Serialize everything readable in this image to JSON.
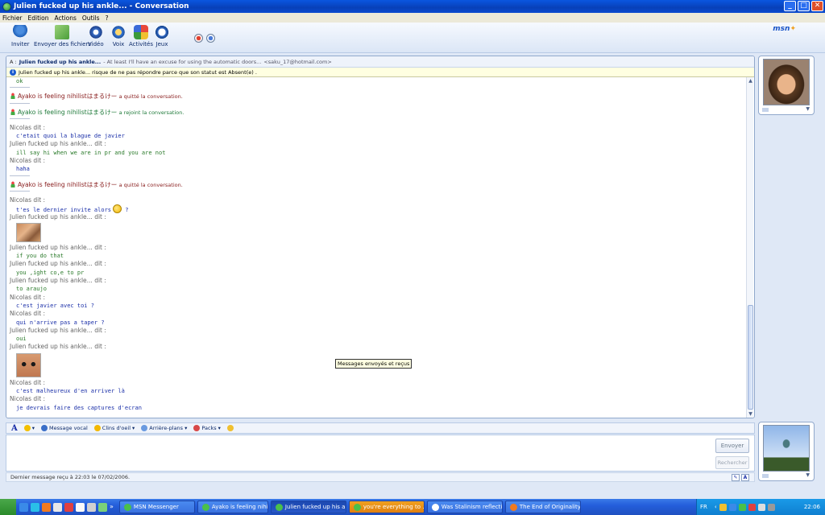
{
  "window": {
    "title": "Julien fucked up his ankle... - Conversation",
    "controls": [
      "_",
      "□",
      "✕"
    ]
  },
  "menu": [
    "Fichier",
    "Edition",
    "Actions",
    "Outils",
    "?"
  ],
  "toolbar": {
    "buttons": [
      {
        "label": "Inviter",
        "icon": "invite-icon"
      },
      {
        "label": "Envoyer des fichiers",
        "icon": "send-files-icon"
      },
      {
        "label": "Vidéo",
        "icon": "video-icon"
      },
      {
        "label": "Voix",
        "icon": "voice-icon"
      },
      {
        "label": "Activités",
        "icon": "activities-icon"
      },
      {
        "label": "Jeux",
        "icon": "games-icon"
      }
    ],
    "logo": "msn"
  },
  "conversation": {
    "to_prefix": "A :",
    "to_name": "Julien fucked up his ankle...",
    "to_message": "- At least I'll have an excuse for using the automatic doors...",
    "to_email": "<saku_17@hotmail.com>",
    "info_banner": "Julien fucked up his ankle... risque de ne pas répondre parce que son statut est Absent(e) ."
  },
  "messages": {
    "m0": "ok",
    "s1_name": "Ayako is feeling nihilistはまるけー",
    "s1_verb": "a quitté la conversation.",
    "s2_name": "Ayako is feeling nihilistはまるけー",
    "s2_verb": "a rejoint la conversation.",
    "h1": "Nicolas dit :",
    "b1": "c'etait quoi la blague de javier",
    "h2": "Julien fucked up his ankle... dit :",
    "b2": "ill say hi when we are in pr and you are not",
    "h3": "Nicolas dit :",
    "b3": "haha",
    "s3_name": "Ayako is feeling nihilistはまるけー",
    "s3_verb": "a quitté la conversation.",
    "h4": "Nicolas dit :",
    "b4": "t'es le dernier invite alors",
    "b4_tail": "?",
    "h5": "Julien fucked up his ankle... dit :",
    "h6": "Julien fucked up his ankle... dit :",
    "b6": "if you do that",
    "h7": "Julien fucked up his ankle... dit :",
    "b7": "you ,ight co,e to pr",
    "h8": "Julien fucked up his ankle... dit :",
    "b8": "to araujo",
    "h9": "Nicolas dit :",
    "b9": "c'est javier avec toi ?",
    "h10": "Nicolas dit :",
    "b10": "qui n'arrive pas a taper ?",
    "h11": "Julien fucked up his ankle... dit :",
    "b11": "oui",
    "h12": "Julien fucked up his ankle... dit :",
    "h13": "Nicolas dit :",
    "b13": "c'est malheureux d'en arriver là",
    "h14": "Nicolas dit :",
    "b14": "je devrais faire des captures d'ecran"
  },
  "tooltip": "Messages envoyés et reçus",
  "format_bar": {
    "font_label": "A",
    "voice": "Message vocal",
    "winks": "Clins d'oeil",
    "backgrounds": "Arrière-plans",
    "packs": "Packs"
  },
  "compose": {
    "send_label": "Envoyer",
    "search_label": "Rechercher"
  },
  "status_bar": {
    "text": "Dernier message reçu à 22:03 le 07/02/2006."
  },
  "taskbar": {
    "tasks": [
      {
        "label": "MSN Messenger",
        "active": false
      },
      {
        "label": "Ayako is feeling nihilist...",
        "active": false
      },
      {
        "label": "Julien fucked up his an...",
        "active": true
      },
      {
        "label": "you're everything to ...",
        "active": false
      },
      {
        "label": "Was Stalinism reflectiv...",
        "active": false
      },
      {
        "label": "The End of Originality ...",
        "active": false
      }
    ],
    "language": "FR",
    "clock": "22:06",
    "overflow": "»"
  }
}
